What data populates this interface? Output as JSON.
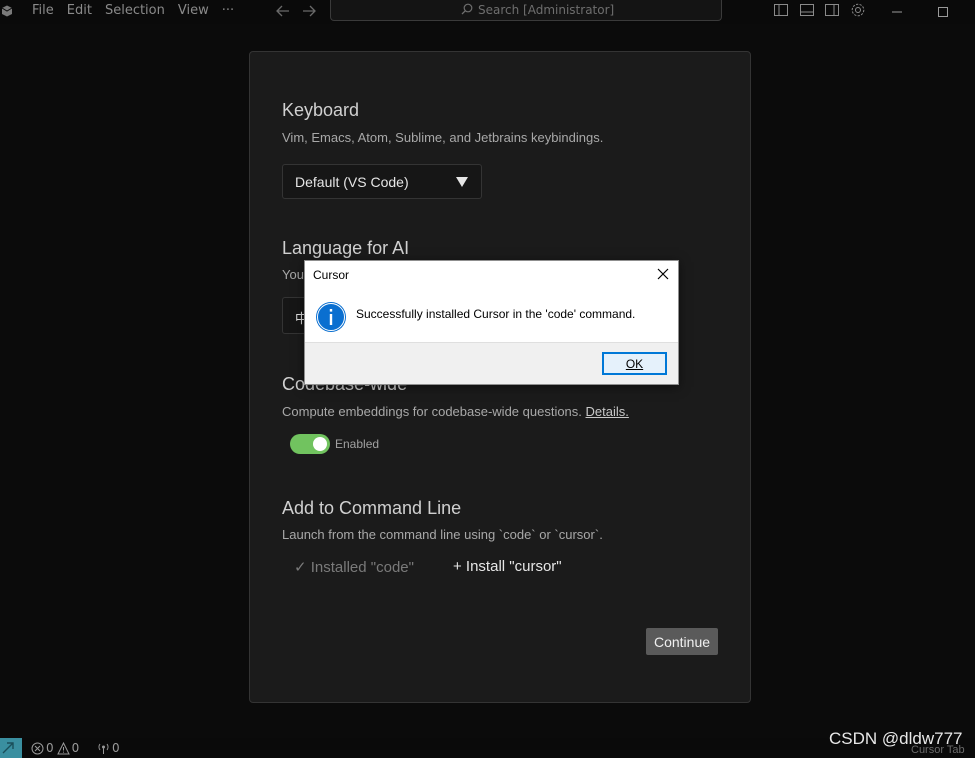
{
  "titlebar": {
    "menu": [
      "File",
      "Edit",
      "Selection",
      "View",
      "···"
    ],
    "search_placeholder": "Search [Administrator]"
  },
  "panel": {
    "keyboard": {
      "title": "Keyboard",
      "description": "Vim, Emacs, Atom, Sublime, and Jetbrains keybindings.",
      "selected": "Default (VS Code)"
    },
    "language": {
      "title": "Language for AI",
      "description_visible": "You",
      "selected_visible": "中"
    },
    "codebase": {
      "title": "Codebase-wide",
      "description": "Compute embeddings for codebase-wide questions.",
      "details_link": "Details.",
      "toggle_label": "Enabled",
      "toggle_on": true
    },
    "command_line": {
      "title": "Add to Command Line",
      "description": "Launch from the command line using `code` or `cursor`.",
      "installed_code": "✓ Installed \"code\"",
      "install_cursor": "+ Install \"cursor\""
    },
    "continue_label": "Continue"
  },
  "dialog": {
    "title": "Cursor",
    "message": "Successfully installed Cursor in the 'code' command.",
    "ok_label": "OK"
  },
  "statusbar": {
    "errors": "0",
    "warnings": "0",
    "ports": "0",
    "right_text": "Cursor Tab"
  },
  "watermark": "CSDN @dldw777",
  "colors": {
    "toggle_on": "#71c35f",
    "info_blue": "#0a6fd0",
    "ok_border": "#0078d7"
  }
}
